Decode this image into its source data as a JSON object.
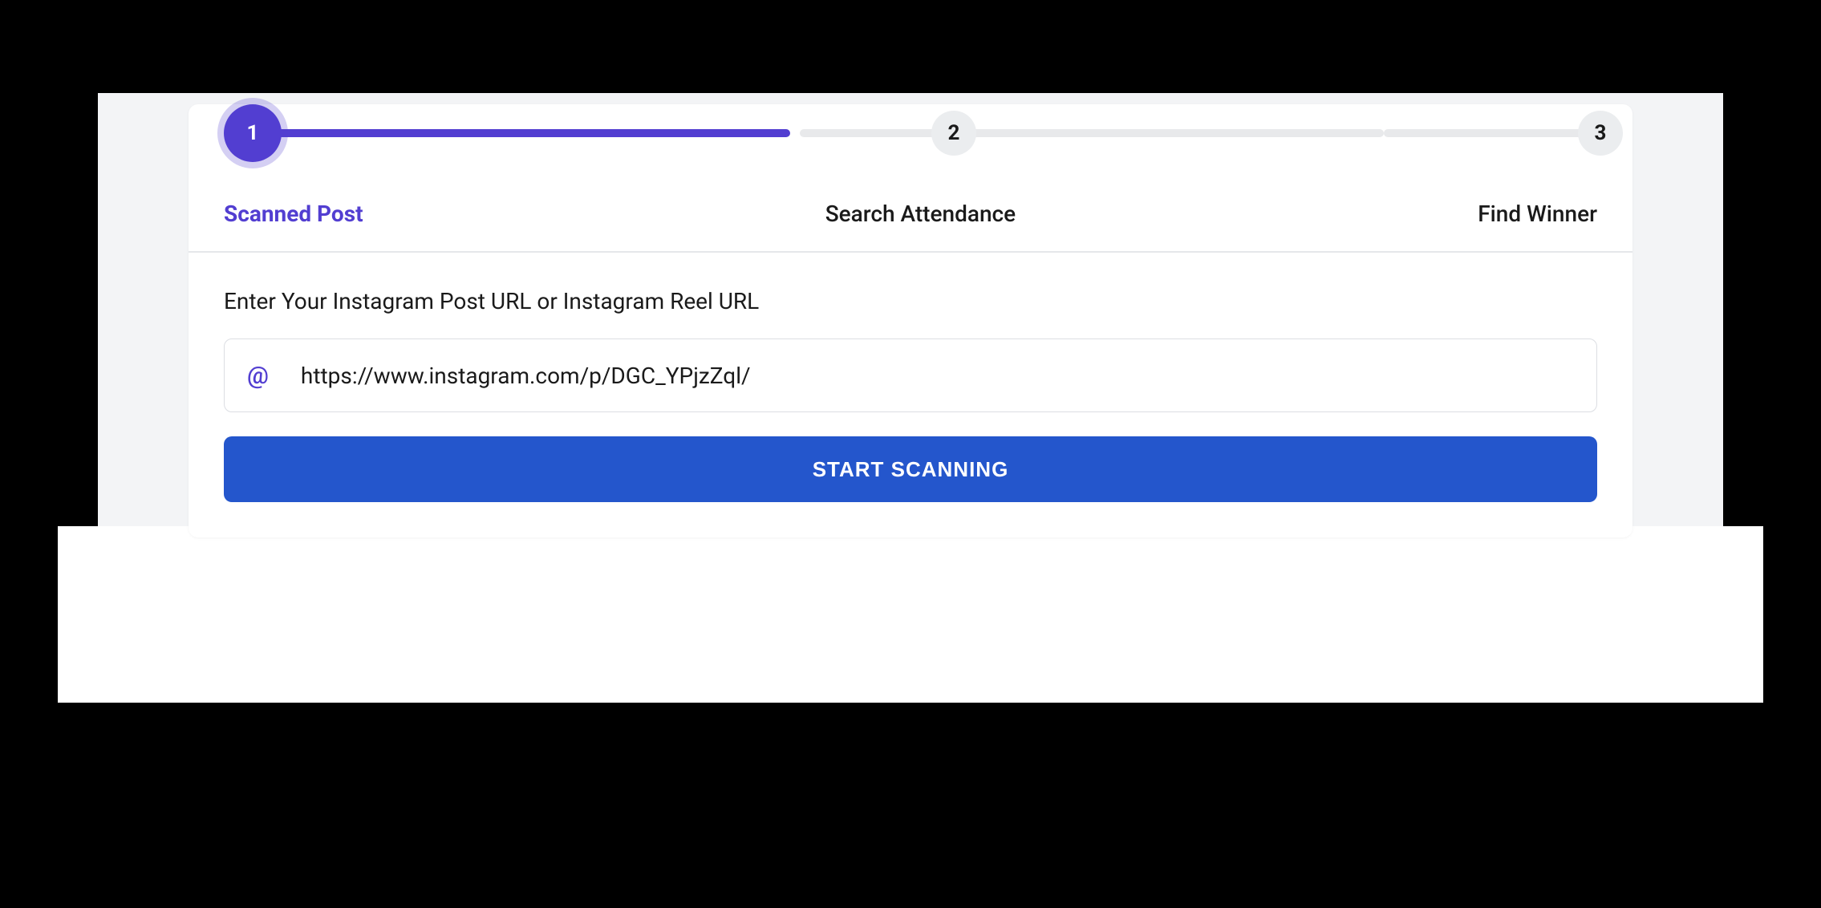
{
  "stepper": {
    "steps": [
      {
        "number": "1",
        "label": "Scanned Post"
      },
      {
        "number": "2",
        "label": "Search Attendance"
      },
      {
        "number": "3",
        "label": "Find Winner"
      }
    ]
  },
  "form": {
    "label": "Enter Your Instagram Post URL or Instagram Reel URL",
    "url_value": "https://www.instagram.com/p/DGC_YPjzZql/",
    "submit_label": "START SCANNING"
  }
}
